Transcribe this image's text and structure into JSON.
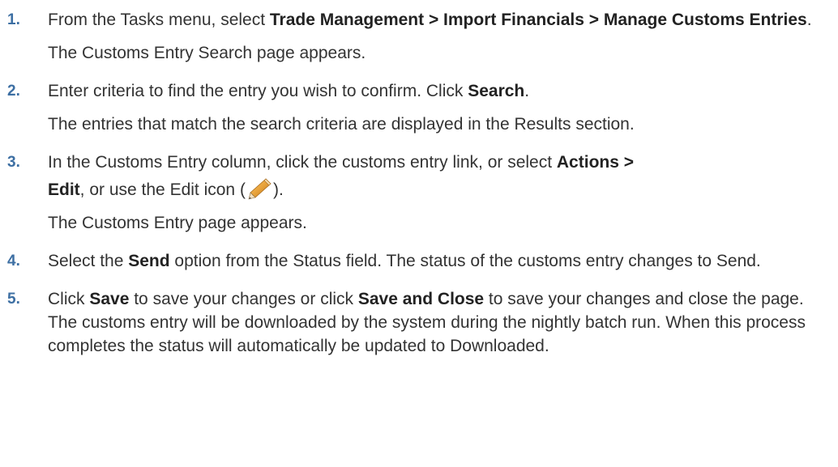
{
  "steps": [
    {
      "number": "1.",
      "parts": [
        {
          "text": "From the Tasks menu, select ",
          "bold": false
        },
        {
          "text": "Trade Management > Import Financials > Manage Customs Entries",
          "bold": true
        },
        {
          "text": ".",
          "bold": false
        }
      ],
      "result": "The Customs Entry Search page appears."
    },
    {
      "number": "2.",
      "parts": [
        {
          "text": "Enter criteria to find the entry you wish to confirm. Click ",
          "bold": false
        },
        {
          "text": "Search",
          "bold": true
        },
        {
          "text": ".",
          "bold": false
        }
      ],
      "result": "The entries that match the search criteria are displayed in the Results section."
    },
    {
      "number": "3.",
      "line1_prefix": "In the Customs Entry column, click the customs entry link, or select ",
      "line1_bold": "Actions >",
      "line2_bold": "Edit",
      "line2_middle": ", or use the Edit icon (",
      "line2_suffix": ").",
      "icon": "pencil-edit-icon",
      "result": "The Customs Entry page appears."
    },
    {
      "number": "4.",
      "parts": [
        {
          "text": "Select the ",
          "bold": false
        },
        {
          "text": "Send",
          "bold": true
        },
        {
          "text": " option from the Status field. The status of the customs entry changes to Send.",
          "bold": false
        }
      ],
      "result": ""
    },
    {
      "number": "5.",
      "parts": [
        {
          "text": "Click ",
          "bold": false
        },
        {
          "text": "Save",
          "bold": true
        },
        {
          "text": " to save your changes or click ",
          "bold": false
        },
        {
          "text": "Save and Close",
          "bold": true
        },
        {
          "text": " to save your changes and close the page. The customs entry will be downloaded by the system during the nightly batch run. When this process completes the status will automatically be updated to Downloaded.",
          "bold": false
        }
      ],
      "result": ""
    }
  ],
  "colors": {
    "step_number": "#3d6fa3",
    "body_text": "#333333",
    "pencil_body": "#e8a23a",
    "pencil_tip": "#555555"
  }
}
